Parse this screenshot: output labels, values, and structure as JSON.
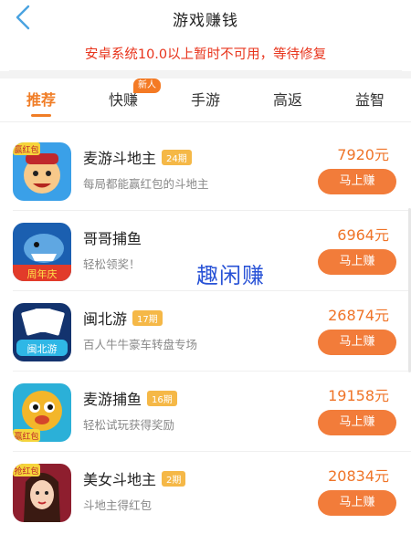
{
  "header": {
    "title": "游戏赚钱"
  },
  "notice": {
    "text": "安卓系统10.0以上暂时不可用，等待修复"
  },
  "tabs": [
    {
      "label": "推荐",
      "active": true
    },
    {
      "label": "快赚",
      "active": false
    },
    {
      "label": "手游",
      "active": false
    },
    {
      "label": "高返",
      "active": false
    },
    {
      "label": "益智",
      "active": false
    }
  ],
  "tab_badge": "新人",
  "games": [
    {
      "name": "麦游斗地主",
      "period": "24期",
      "desc": "每局都能赢红包的斗地主",
      "reward": "7920元",
      "button": "马上赚",
      "icon": "landlord-cards-game-icon",
      "icon_text": "赢红包"
    },
    {
      "name": "哥哥捕鱼",
      "period": "",
      "desc": "轻松领奖！",
      "reward": "6964元",
      "button": "马上赚",
      "icon": "shark-fishing-game-icon",
      "icon_text": "周年庆"
    },
    {
      "name": "闽北游",
      "period": "17期",
      "desc": "百人牛牛豪车转盘专场",
      "reward": "26874元",
      "button": "马上赚",
      "icon": "poker-cards-game-icon",
      "icon_text": "闽北游"
    },
    {
      "name": "麦游捕鱼",
      "period": "16期",
      "desc": "轻松试玩获得奖励",
      "reward": "19158元",
      "button": "马上赚",
      "icon": "pufferfish-game-icon",
      "icon_text": "赢红包"
    },
    {
      "name": "美女斗地主",
      "period": "2期",
      "desc": "斗地主得红包",
      "reward": "20834元",
      "button": "马上赚",
      "icon": "girl-landlord-game-icon",
      "icon_text": "抢红包"
    }
  ],
  "watermark": "趣闲赚",
  "colors": {
    "accent": "#f07d26",
    "notice": "#e8341c",
    "button": "#f27c3a",
    "period_tag": "#f5b847",
    "back_arrow": "#4aa3e0"
  }
}
